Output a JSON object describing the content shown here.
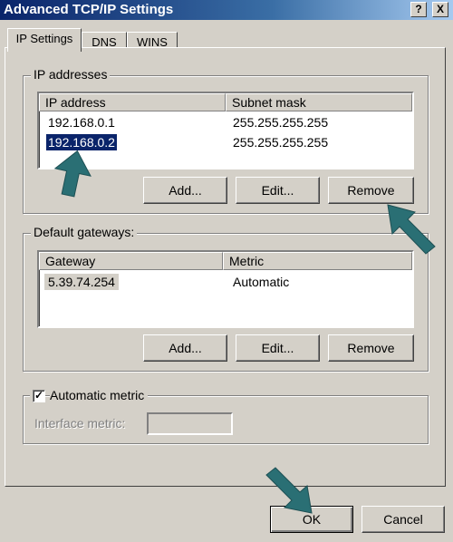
{
  "window": {
    "title": "Advanced TCP/IP Settings",
    "help_glyph": "?",
    "close_glyph": "X"
  },
  "tabs": [
    {
      "label": "IP Settings",
      "active": true
    },
    {
      "label": "DNS",
      "active": false
    },
    {
      "label": "WINS",
      "active": false
    }
  ],
  "ip_addresses": {
    "group_label": "IP addresses",
    "columns": [
      "IP address",
      "Subnet mask"
    ],
    "rows": [
      {
        "ip": "192.168.0.1",
        "mask": "255.255.255.255",
        "selected": false
      },
      {
        "ip": "192.168.0.2",
        "mask": "255.255.255.255",
        "selected": true
      }
    ],
    "add_label": "Add...",
    "edit_label": "Edit...",
    "remove_label": "Remove"
  },
  "gateways": {
    "group_label": "Default gateways:",
    "columns": [
      "Gateway",
      "Metric"
    ],
    "rows": [
      {
        "gateway": "5.39.74.254",
        "metric": "Automatic"
      }
    ],
    "add_label": "Add...",
    "edit_label": "Edit...",
    "remove_label": "Remove"
  },
  "metric": {
    "checkbox_label": "Automatic metric",
    "checked": true,
    "check_glyph": "✓",
    "interface_label": "Interface metric:",
    "interface_value": ""
  },
  "footer": {
    "ok_label": "OK",
    "cancel_label": "Cancel"
  },
  "colors": {
    "selection": "#0a246a",
    "arrow": "#2a6f74"
  }
}
